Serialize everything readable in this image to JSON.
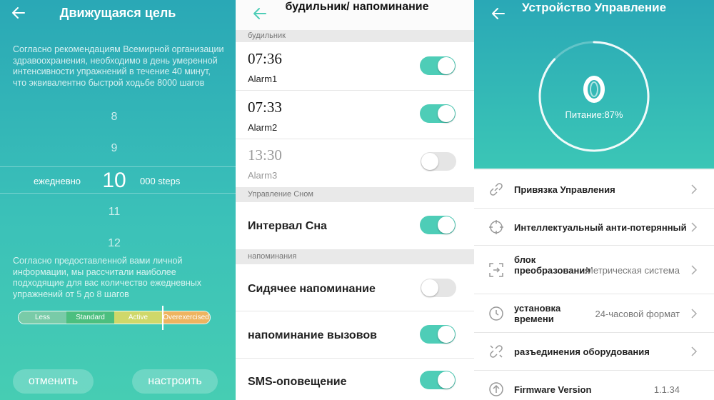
{
  "goal_screen": {
    "title": "Движущаяся цель",
    "intro": "Согласно рекомендациям Всемирной организации здравоохранения, необходимо в день умеренной интенсивности упражнений в течение 40 минут, что эквивалентно быстрой ходьбе 8000 шагов",
    "picker": {
      "prefix": "ежедневно",
      "values": [
        "8",
        "9",
        "10",
        "11",
        "12"
      ],
      "selected": "10",
      "suffix": "000 steps"
    },
    "info": "Согласно предоставленной вами личной информации, мы рассчитали наиболее подходящие для вас количество ежедневных упражнений от 5 до 8 шагов",
    "levels": [
      "Less",
      "Standard",
      "Active",
      "Overexercised"
    ],
    "level_colors": [
      "#79cba8",
      "#4cbf7f",
      "#cfd86a",
      "#eeb460"
    ],
    "cancel_label": "отменить",
    "confirm_label": "настроить"
  },
  "alarm_screen": {
    "title": "будильник/ напоминание",
    "section_alarm": "будильник",
    "alarms": [
      {
        "time": "07:36",
        "name": "Alarm1",
        "enabled": true
      },
      {
        "time": "07:33",
        "name": "Alarm2",
        "enabled": true
      },
      {
        "time": "13:30",
        "name": "Alarm3",
        "enabled": false
      }
    ],
    "section_sleep": "Управление Сном",
    "sleep_label": "Интервал Сна",
    "section_reminders": "напоминания",
    "reminders": [
      {
        "label": "Сидячее напоминание",
        "enabled": false
      },
      {
        "label": "напоминание вызовов",
        "enabled": true
      },
      {
        "label": "SMS-оповещение",
        "enabled": true
      }
    ]
  },
  "device_screen": {
    "title": "Устройство Управление",
    "battery_label": "Питание:87%",
    "battery_percent": 87,
    "items": [
      {
        "label": "Привязка Управления",
        "value": "",
        "icon": "link-icon"
      },
      {
        "label": "Интеллектуальный анти-потерянный",
        "value": "",
        "icon": "crosshair-icon"
      },
      {
        "label": "блок преобразования",
        "value": "Метрическая система",
        "icon": "convert-icon"
      },
      {
        "label": "установка времени",
        "value": "24-часовой формат",
        "icon": "clock-icon"
      },
      {
        "label": "разъединения оборудования",
        "value": "",
        "icon": "unlink-icon"
      },
      {
        "label": "Firmware Version",
        "value": "1.1.34",
        "icon": "upload-icon"
      }
    ]
  }
}
